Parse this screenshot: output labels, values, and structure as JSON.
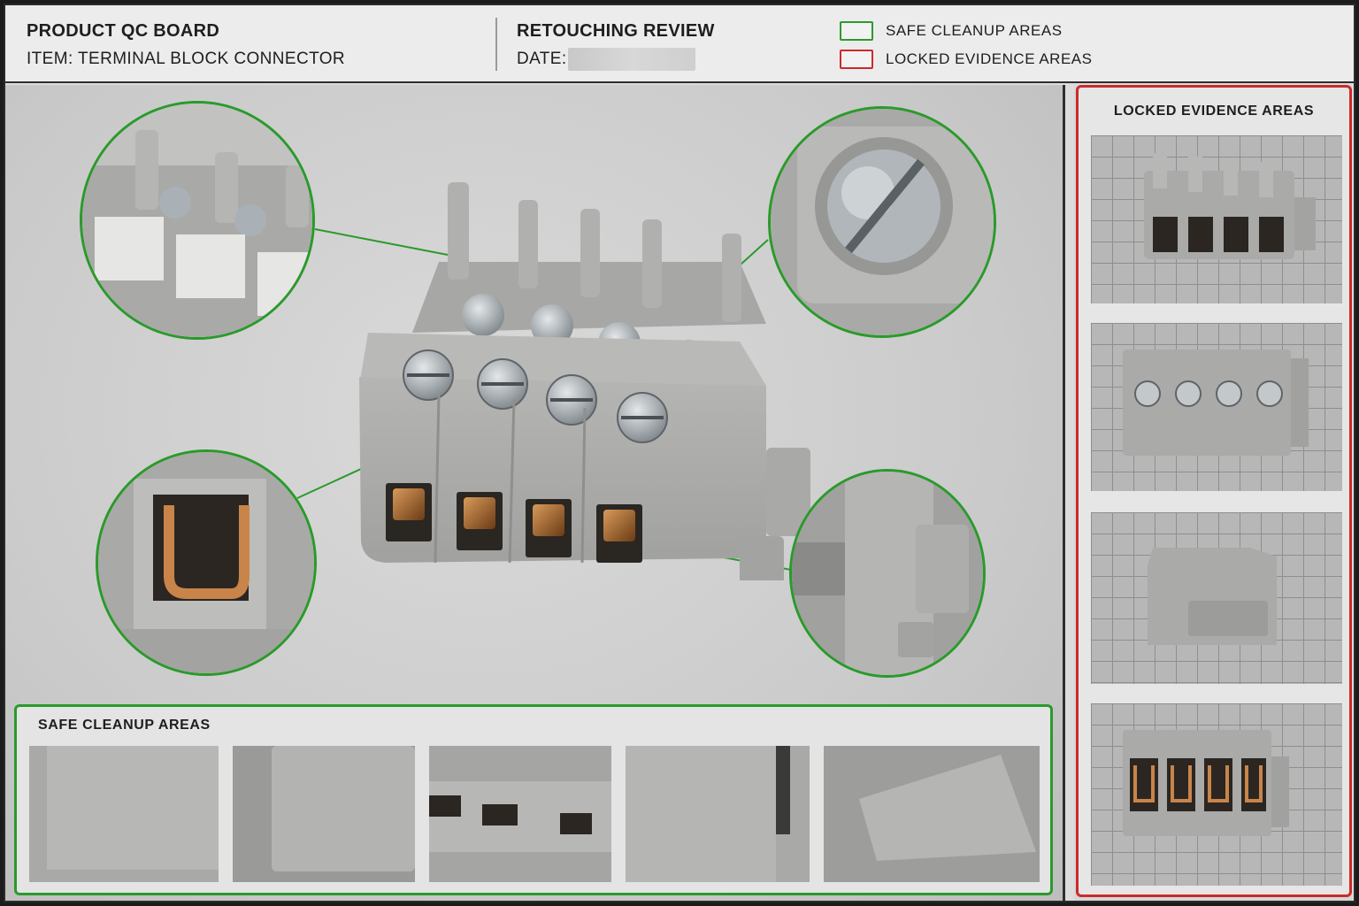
{
  "header": {
    "board_title": "PRODUCT QC BOARD",
    "item_line": "ITEM: TERMINAL BLOCK CONNECTOR",
    "review_title": "RETOUCHING REVIEW",
    "date_label": "DATE:"
  },
  "legend": {
    "safe_label": "SAFE CLEANUP AREAS",
    "locked_label": "LOCKED EVIDENCE AREAS",
    "safe_color": "#2e9a2e",
    "locked_color": "#cc2a2a"
  },
  "safe_panel": {
    "title": "SAFE CLEANUP AREAS"
  },
  "locked_panel": {
    "title": "LOCKED EVIDENCE AREAS"
  },
  "icons": [
    "terminal-block-photo",
    "screw-icon",
    "zoom-callout"
  ]
}
